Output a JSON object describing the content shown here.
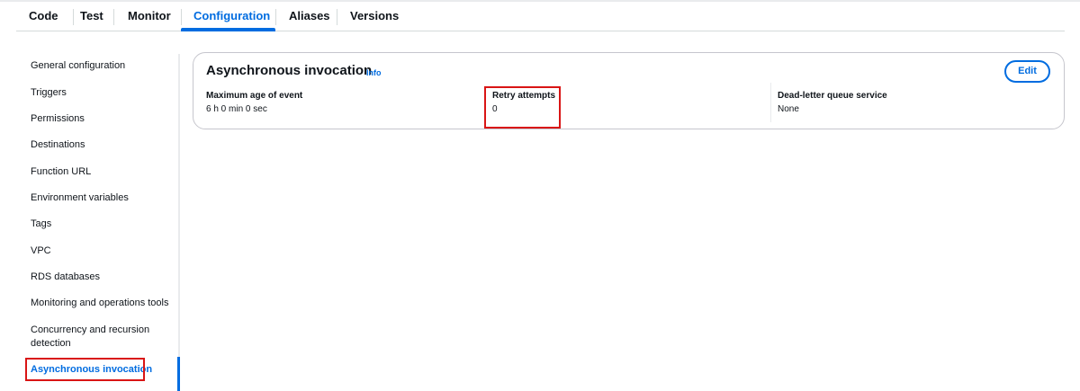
{
  "tabs": [
    {
      "label": "Code"
    },
    {
      "label": "Test"
    },
    {
      "label": "Monitor"
    },
    {
      "label": "Configuration",
      "active": true
    },
    {
      "label": "Aliases"
    },
    {
      "label": "Versions"
    }
  ],
  "sidebar": {
    "items": [
      {
        "label": "General configuration"
      },
      {
        "label": "Triggers"
      },
      {
        "label": "Permissions"
      },
      {
        "label": "Destinations"
      },
      {
        "label": "Function URL"
      },
      {
        "label": "Environment variables"
      },
      {
        "label": "Tags"
      },
      {
        "label": "VPC"
      },
      {
        "label": "RDS databases"
      },
      {
        "label": "Monitoring and operations tools"
      },
      {
        "label": "Concurrency and recursion detection"
      },
      {
        "label": "Asynchronous invocation",
        "active": true
      }
    ]
  },
  "panel": {
    "title": "Asynchronous invocation",
    "info_label": "Info",
    "edit_label": "Edit",
    "fields": [
      {
        "label": "Maximum age of event",
        "value": "6  h   0  min   0  sec"
      },
      {
        "label": "Retry attempts",
        "value": "0"
      },
      {
        "label": "Dead-letter queue service",
        "value": "None"
      }
    ]
  },
  "colors": {
    "accent": "#006ce0",
    "highlight": "#d91515",
    "text": "#0f141a",
    "border": "#c6c6cd"
  }
}
